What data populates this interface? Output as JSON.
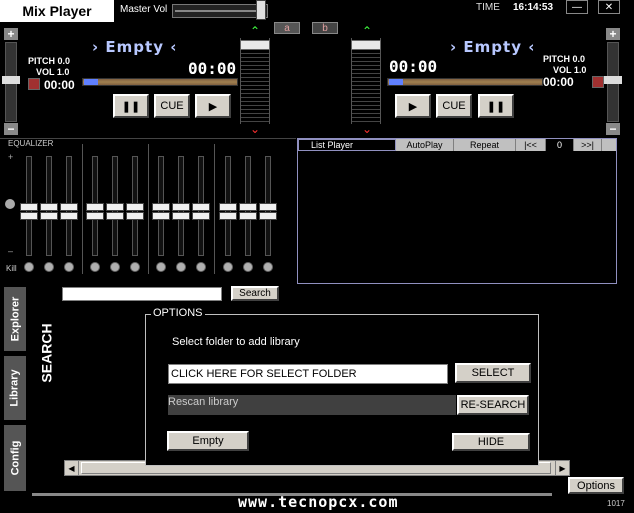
{
  "app": {
    "title": "Mix Player",
    "master_vol_label": "Master Vol",
    "time_label": "TIME",
    "time_value": "16:14:53",
    "master_vol_level": 0.88
  },
  "window_buttons": {
    "minimize": "—",
    "close": "✕"
  },
  "ab": {
    "a": "a",
    "b": "b"
  },
  "deck_left": {
    "name": "Empty",
    "time_main": "00:00",
    "time_small": "00:00",
    "pitch": "PITCH 0.0",
    "vol": "VOL 1.0",
    "cue": "CUE"
  },
  "deck_right": {
    "name": "Empty",
    "time_main": "00:00",
    "time_small": "00:00",
    "pitch": "PITCH 0.0",
    "vol": "VOL 1.0",
    "cue": "CUE"
  },
  "equalizer": {
    "label": "EQUALIZER",
    "kill_label": "Kill",
    "plus": "+",
    "minus": "–"
  },
  "list_player": {
    "title": "List Player",
    "autoplay": "AutoPlay",
    "repeat": "Repeat",
    "prev": "|<<",
    "counter": "0",
    "next": ">>|"
  },
  "search": {
    "value": "",
    "button": "Search",
    "label": "SEARCH"
  },
  "tabs": {
    "explorer": "Explorer",
    "library": "Library",
    "config": "Config"
  },
  "options": {
    "legend": "OPTIONS",
    "select_folder_label": "Select folder to add library",
    "folder_field": "CLICK HERE FOR SELECT FOLDER",
    "select_button": "SELECT",
    "rescan_label": "Rescan library",
    "research_button": "RE-SEARCH",
    "empty_button": "Empty",
    "hide_button": "HIDE"
  },
  "footer": {
    "options_button": "Options",
    "version": "1017",
    "watermark": "www.tecnopcx.com"
  }
}
